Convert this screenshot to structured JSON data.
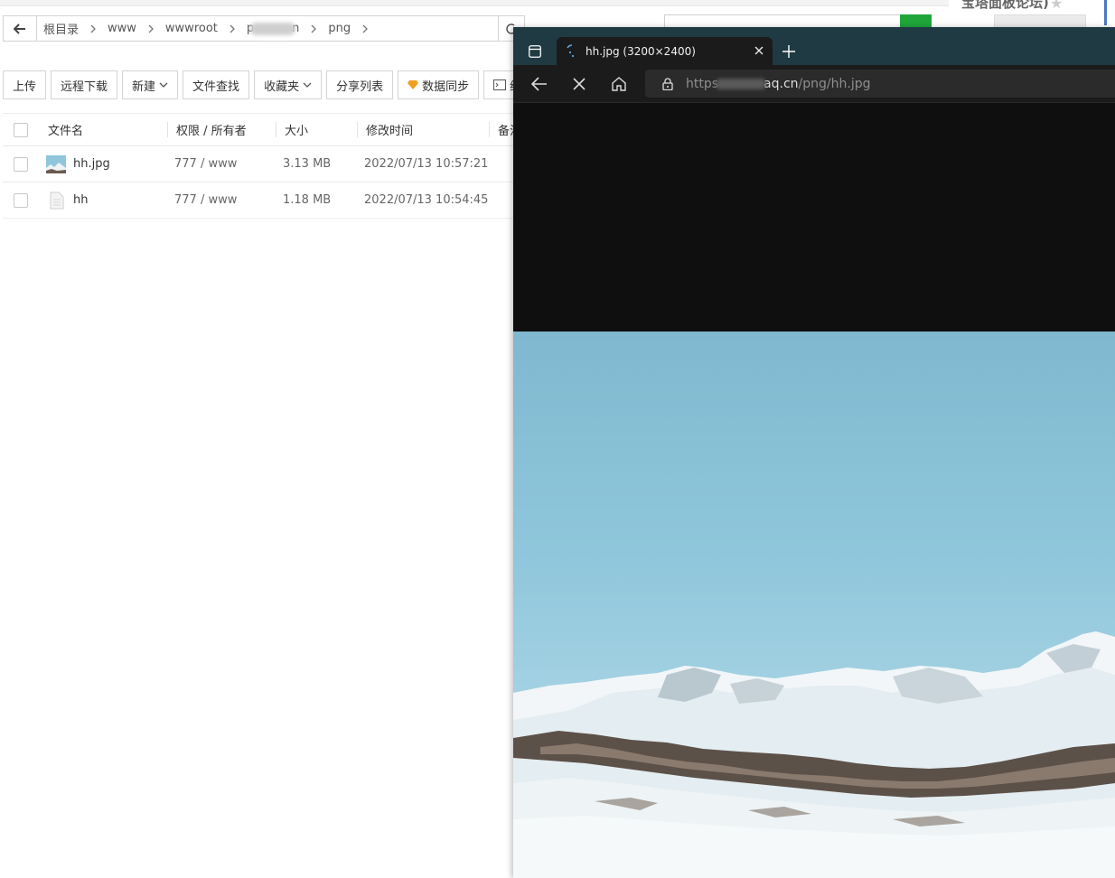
{
  "file_manager": {
    "breadcrumbs": [
      "根目录",
      "www",
      "wwwroot",
      "p",
      "n",
      "png"
    ],
    "right_title": "宝塔面板论坛)",
    "toolbar": {
      "upload": "上传",
      "remote_download": "远程下载",
      "new": "新建",
      "file_search": "文件查找",
      "favorites": "收藏夹",
      "share_list": "分享列表",
      "data_sync": "数据同步",
      "terminal": "终端"
    },
    "columns": {
      "name": "文件名",
      "perm": "权限 / 所有者",
      "size": "大小",
      "mtime": "修改时间",
      "note": "备注"
    },
    "rows": [
      {
        "name": "hh.jpg",
        "perm": "777 / www",
        "size": "3.13 MB",
        "mtime": "2022/07/13 10:57:21",
        "icon": "image-thumbnail-icon"
      },
      {
        "name": "hh",
        "perm": "777 / www",
        "size": "1.18 MB",
        "mtime": "2022/07/13 10:54:45",
        "icon": "file-icon"
      }
    ]
  },
  "browser": {
    "tab_title": "hh.jpg (3200×2400)",
    "url_scheme": "https",
    "url_host_suffix": "aq.cn",
    "url_path": "/png/hh.jpg",
    "theme_color": "#1f3a42"
  },
  "colors": {
    "accent_green": "#20a53a",
    "sky_blue": "#8fc6db"
  }
}
